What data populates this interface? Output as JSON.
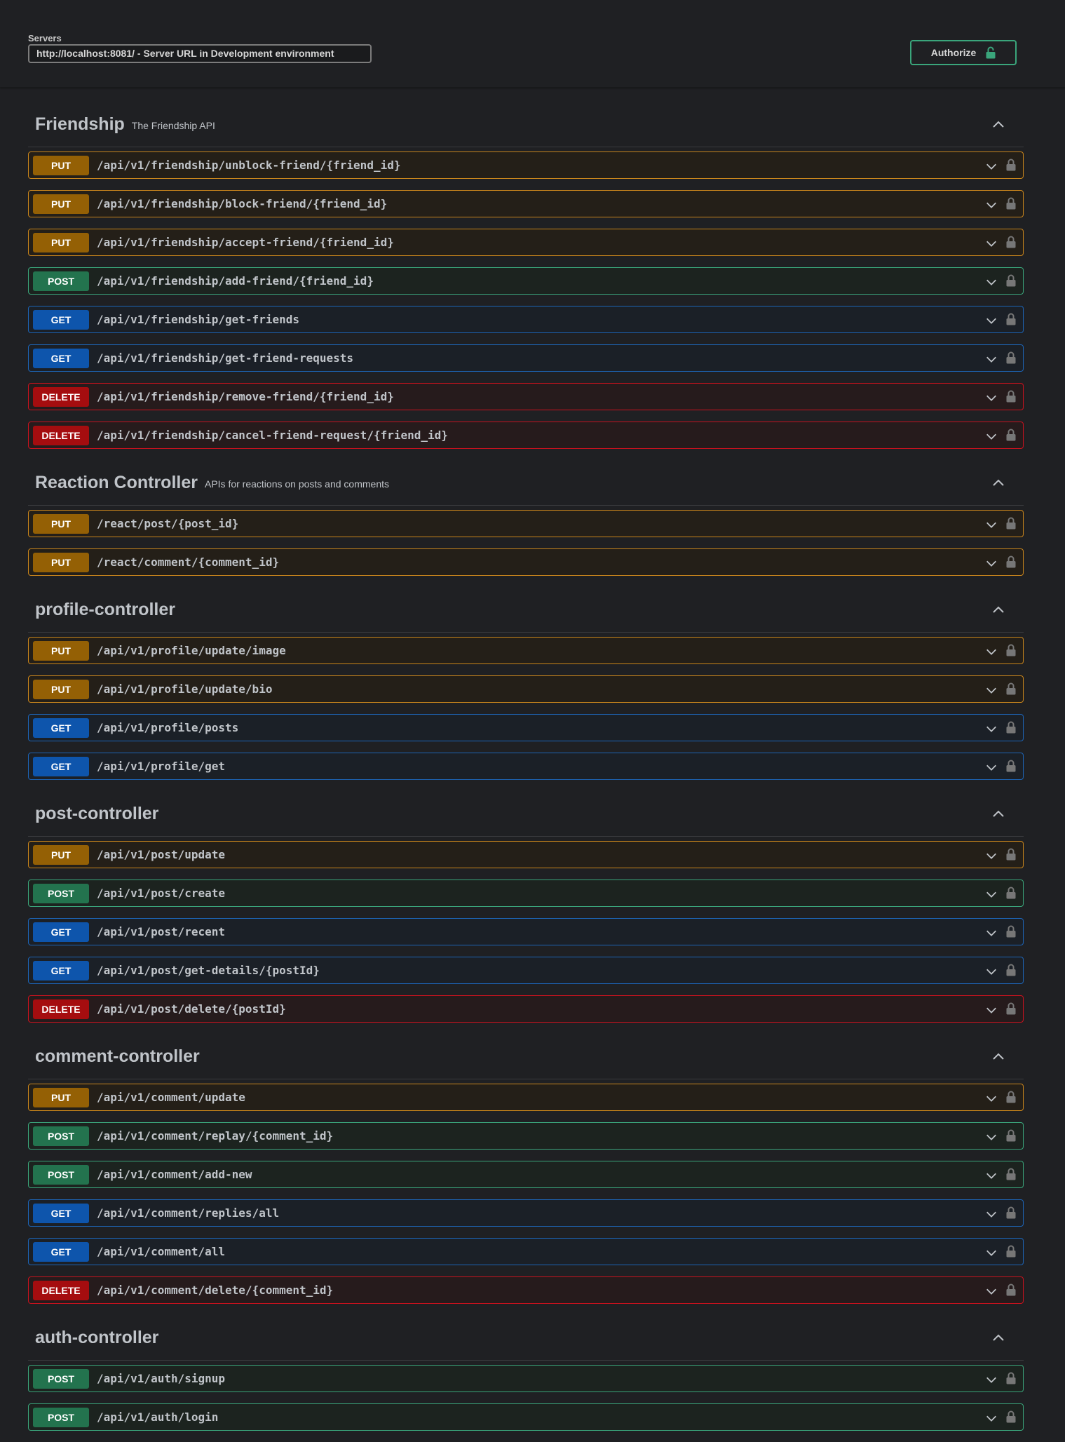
{
  "servers": {
    "label": "Servers",
    "selected": "http://localhost:8081/ - Server URL in Development environment"
  },
  "authorize": {
    "label": "Authorize",
    "icon": "unlocked-lock-icon"
  },
  "colors": {
    "put": "#946005",
    "post": "#23734e",
    "get": "#0e55ac",
    "delete": "#a50d0f",
    "authorize": "#3aa57b"
  },
  "tags": [
    {
      "name": "Friendship",
      "description": "The Friendship API",
      "operations": [
        {
          "method": "PUT",
          "path": "/api/v1/friendship/unblock-friend/{friend_id}"
        },
        {
          "method": "PUT",
          "path": "/api/v1/friendship/block-friend/{friend_id}"
        },
        {
          "method": "PUT",
          "path": "/api/v1/friendship/accept-friend/{friend_id}"
        },
        {
          "method": "POST",
          "path": "/api/v1/friendship/add-friend/{friend_id}"
        },
        {
          "method": "GET",
          "path": "/api/v1/friendship/get-friends"
        },
        {
          "method": "GET",
          "path": "/api/v1/friendship/get-friend-requests"
        },
        {
          "method": "DELETE",
          "path": "/api/v1/friendship/remove-friend/{friend_id}"
        },
        {
          "method": "DELETE",
          "path": "/api/v1/friendship/cancel-friend-request/{friend_id}"
        }
      ]
    },
    {
      "name": "Reaction Controller",
      "description": "APIs for reactions on posts and comments",
      "operations": [
        {
          "method": "PUT",
          "path": "/react/post/{post_id}"
        },
        {
          "method": "PUT",
          "path": "/react/comment/{comment_id}"
        }
      ]
    },
    {
      "name": "profile-controller",
      "description": "",
      "operations": [
        {
          "method": "PUT",
          "path": "/api/v1/profile/update/image"
        },
        {
          "method": "PUT",
          "path": "/api/v1/profile/update/bio"
        },
        {
          "method": "GET",
          "path": "/api/v1/profile/posts"
        },
        {
          "method": "GET",
          "path": "/api/v1/profile/get"
        }
      ]
    },
    {
      "name": "post-controller",
      "description": "",
      "operations": [
        {
          "method": "PUT",
          "path": "/api/v1/post/update"
        },
        {
          "method": "POST",
          "path": "/api/v1/post/create"
        },
        {
          "method": "GET",
          "path": "/api/v1/post/recent"
        },
        {
          "method": "GET",
          "path": "/api/v1/post/get-details/{postId}"
        },
        {
          "method": "DELETE",
          "path": "/api/v1/post/delete/{postId}"
        }
      ]
    },
    {
      "name": "comment-controller",
      "description": "",
      "operations": [
        {
          "method": "PUT",
          "path": "/api/v1/comment/update"
        },
        {
          "method": "POST",
          "path": "/api/v1/comment/replay/{comment_id}"
        },
        {
          "method": "POST",
          "path": "/api/v1/comment/add-new"
        },
        {
          "method": "GET",
          "path": "/api/v1/comment/replies/all"
        },
        {
          "method": "GET",
          "path": "/api/v1/comment/all"
        },
        {
          "method": "DELETE",
          "path": "/api/v1/comment/delete/{comment_id}"
        }
      ]
    },
    {
      "name": "auth-controller",
      "description": "",
      "operations": [
        {
          "method": "POST",
          "path": "/api/v1/auth/signup"
        },
        {
          "method": "POST",
          "path": "/api/v1/auth/login"
        }
      ]
    }
  ]
}
